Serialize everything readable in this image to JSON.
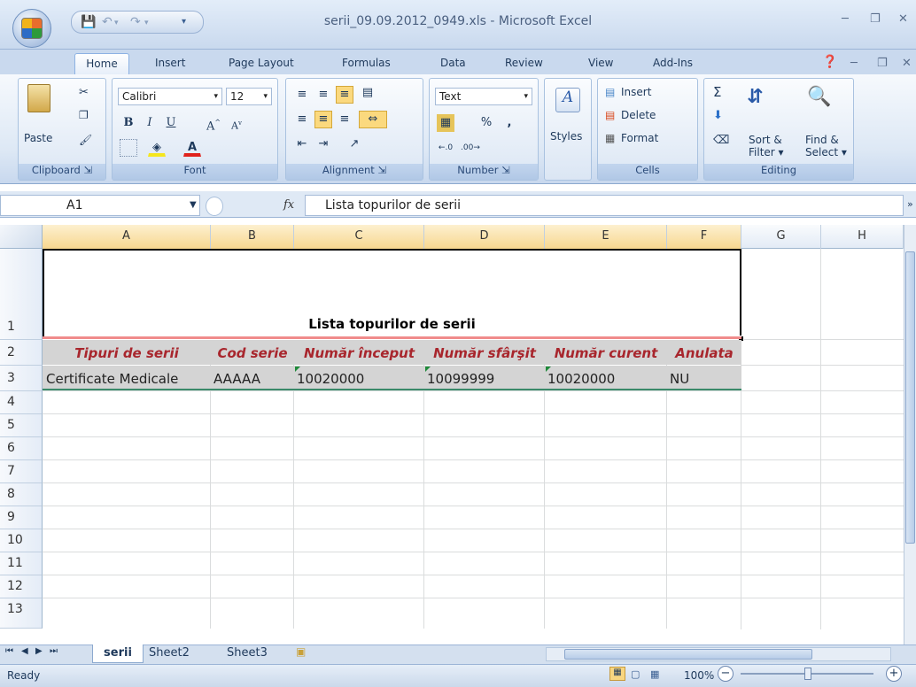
{
  "window": {
    "title": "serii_09.09.2012_0949.xls - Microsoft Excel"
  },
  "tabs": [
    "Home",
    "Insert",
    "Page Layout",
    "Formulas",
    "Data",
    "Review",
    "View",
    "Add-Ins"
  ],
  "ribbon": {
    "clipboard": {
      "label": "Clipboard",
      "paste": "Paste"
    },
    "font": {
      "label": "Font",
      "name": "Calibri",
      "size": "12"
    },
    "alignment": {
      "label": "Alignment"
    },
    "number": {
      "label": "Number",
      "format": "Text",
      "percent": "%",
      "comma": ","
    },
    "styles": {
      "label": "Styles"
    },
    "cells": {
      "label": "Cells",
      "insert": "Insert",
      "delete": "Delete",
      "format": "Format"
    },
    "editing": {
      "label": "Editing",
      "sort": "Sort &",
      "sort2": "Filter",
      "find": "Find &",
      "find2": "Select"
    }
  },
  "formula_bar": {
    "name_box": "A1",
    "fx": "fx",
    "formula": "Lista topurilor de serii"
  },
  "columns": [
    "A",
    "B",
    "C",
    "D",
    "E",
    "F",
    "G",
    "H"
  ],
  "rows": [
    "1",
    "2",
    "3",
    "4",
    "5",
    "6",
    "7",
    "8",
    "9",
    "10",
    "11",
    "12",
    "13"
  ],
  "sheet": {
    "title": "Lista topurilor de serii",
    "headers": [
      "Tipuri de serii",
      "Cod serie",
      "Număr început",
      "Număr sfârşit",
      "Număr curent",
      "Anulata"
    ],
    "row3": [
      "Certificate Medicale",
      "AAAAA",
      "10020000",
      "10099999",
      "10020000",
      "NU"
    ]
  },
  "sheet_tabs": [
    "serii",
    "Sheet2",
    "Sheet3"
  ],
  "status": {
    "ready": "Ready",
    "zoom": "100%"
  },
  "colors": {
    "header_red": "#a8262d",
    "table_fill": "#d4d4d4",
    "accent": "#1e395b"
  }
}
